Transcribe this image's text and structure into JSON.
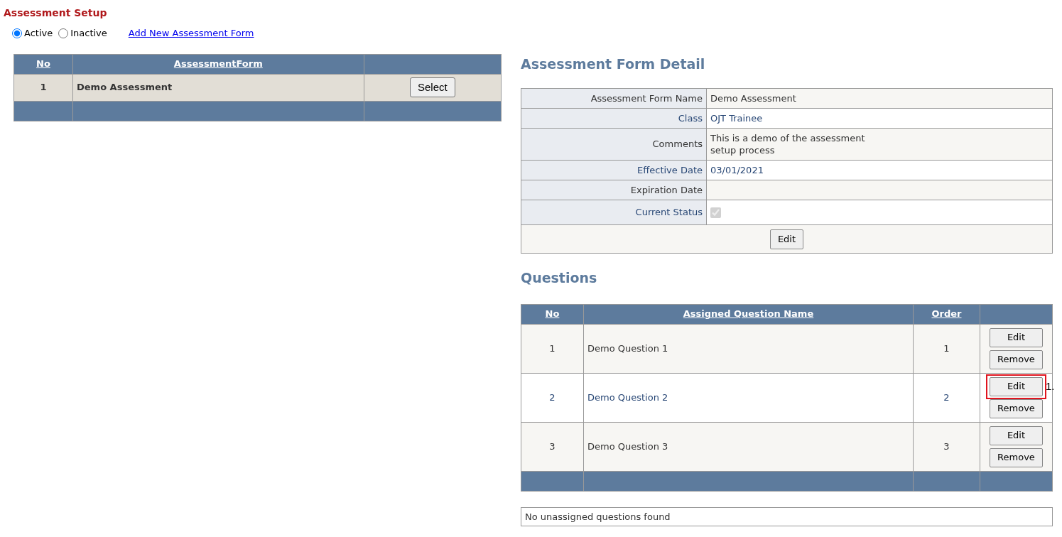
{
  "page_title": "Assessment Setup",
  "status_filter": [
    {
      "label": "Active",
      "selected": true
    },
    {
      "label": "Inactive",
      "selected": false
    }
  ],
  "add_link": "Add New Assessment Form",
  "forms_table": {
    "columns": [
      "No",
      "AssessmentForm"
    ],
    "rows": [
      {
        "no": "1",
        "name": "Demo Assessment",
        "action": "Select"
      }
    ]
  },
  "detail": {
    "title": "Assessment Form Detail",
    "fields": [
      {
        "label": "Assessment Form Name",
        "value": "Demo Assessment"
      },
      {
        "label": "Class",
        "value": "OJT Trainee"
      },
      {
        "label": "Comments",
        "value": "This is a demo of the assessment\nsetup process"
      },
      {
        "label": "Effective Date",
        "value": "03/01/2021"
      },
      {
        "label": "Expiration Date"
      },
      {
        "label": "Current Status",
        "kind": "checkbox",
        "checked": true,
        "disabled": true
      }
    ],
    "edit_button": "Edit"
  },
  "questions": {
    "title": "Questions",
    "columns": [
      "No",
      "Assigned Question Name",
      "Order"
    ],
    "rows": [
      {
        "no": "1",
        "name": "Demo Question 1",
        "order": "1",
        "edit": "Edit",
        "remove": "Remove",
        "highlighted": false
      },
      {
        "no": "2",
        "name": "Demo Question 2",
        "order": "2",
        "edit": "Edit",
        "remove": "Remove",
        "highlighted": true,
        "callout": "1."
      },
      {
        "no": "3",
        "name": "Demo Question 3",
        "order": "3",
        "edit": "Edit",
        "remove": "Remove",
        "highlighted": false
      }
    ],
    "empty_message": "No unassigned questions found"
  }
}
